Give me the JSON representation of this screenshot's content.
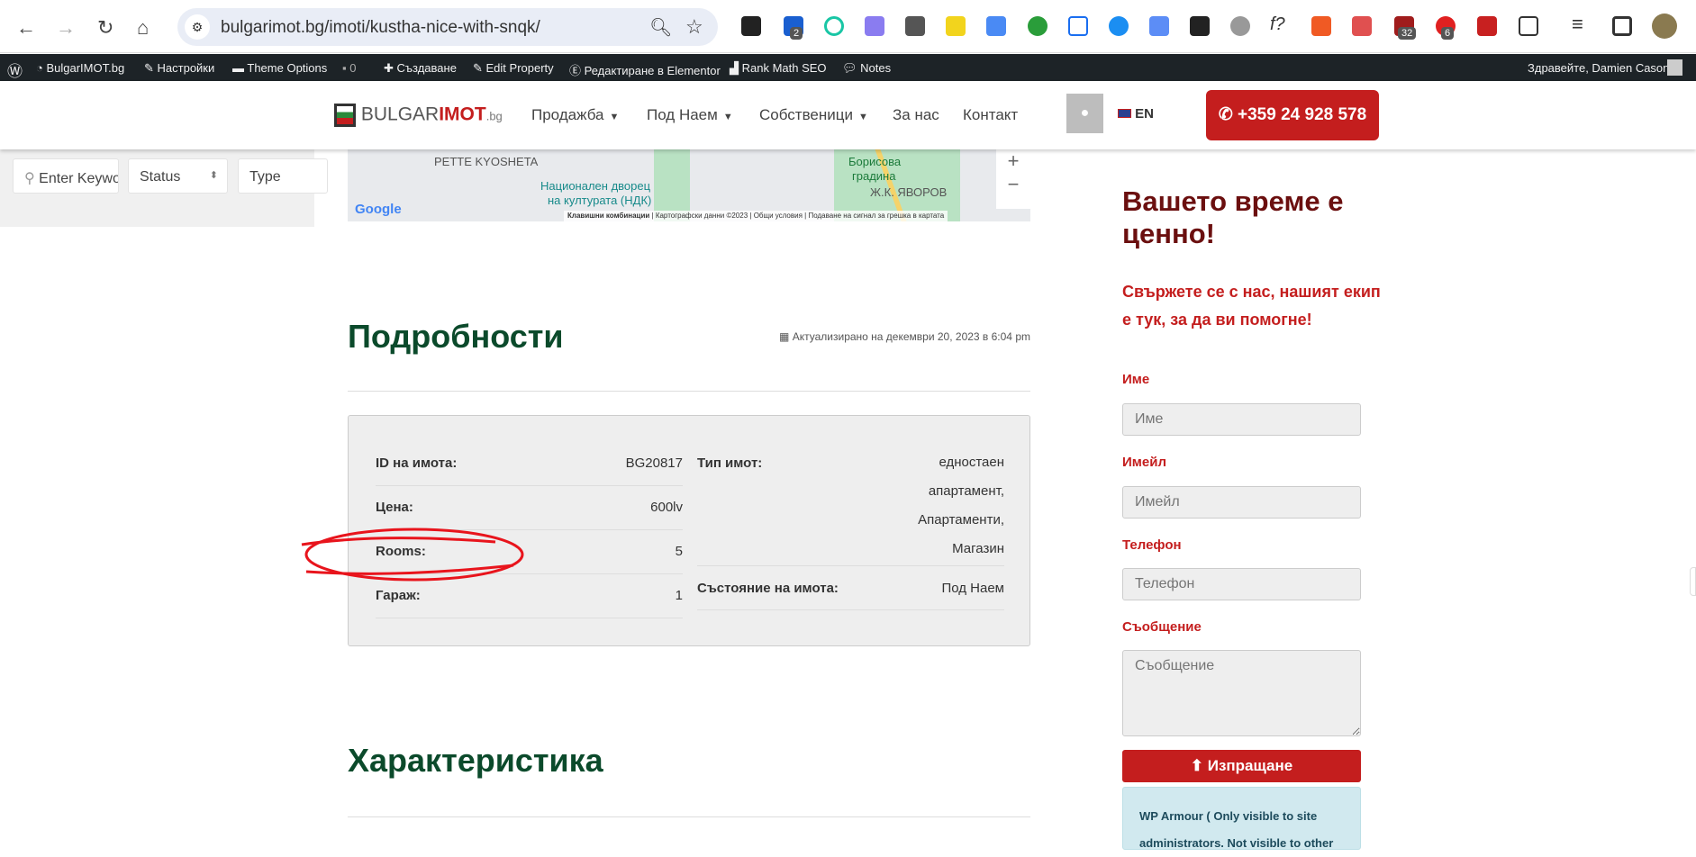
{
  "browser": {
    "url": "bulgarimot.bg/imoti/kustha-nice-with-snqk/",
    "badges": [
      "2",
      "32",
      "6"
    ],
    "ext_f": "f?"
  },
  "adminbar": {
    "items": [
      "BulgarIMOT.bg",
      "Настройки",
      "Theme Options",
      "0",
      "Създаване",
      "Edit Property",
      "Редактиране в Elementor",
      "Rank Math SEO",
      "Notes"
    ],
    "greeting": "Здравейте, Damien Casoni"
  },
  "header": {
    "logo_a": "BULGAR",
    "logo_b": "IMOT",
    "logo_c": ".bg",
    "menu": [
      "Продажба",
      "Под Наем",
      "Собственици",
      "За нас",
      "Контакт"
    ],
    "lang": "EN",
    "phone": "+359 24 928 578"
  },
  "filter": {
    "keyword_placeholder": "Enter Keyword",
    "status": "Status",
    "type": "Type"
  },
  "map": {
    "labels": [
      "PETTE KYOSHETA",
      "Национален дворец",
      "на културата (НДК)",
      "Борисова",
      "градина",
      "Ж.К. ЯВОРОВ"
    ],
    "attribution": [
      "Клавишни комбинации",
      "Картографски данни ©2023",
      "Общи условия",
      "Подаване на сигнал за грешка в картата"
    ],
    "google": "Google"
  },
  "details": {
    "title": "Подробности",
    "updated": "Актуализирано на декември 20, 2023 в 6:04 pm",
    "left": [
      {
        "label": "ID на имота:",
        "value": "BG20817"
      },
      {
        "label": "Цена:",
        "value": "600lv"
      },
      {
        "label": "Rooms:",
        "value": "5"
      },
      {
        "label": "Гараж:",
        "value": "1"
      }
    ],
    "type_label": "Тип имот:",
    "type_lines": [
      "едностаен",
      "апартамент,",
      "Апартаменти,",
      "Магазин"
    ],
    "status_label": "Състояние на имота:",
    "status_value": "Под Наем"
  },
  "features": {
    "title": "Характеристика"
  },
  "sidebar": {
    "title": "Вашето време е ценно!",
    "subtitle": "Свържете се с нас, нашият екип е тук, за да ви помогне!",
    "fields": [
      {
        "label": "Име",
        "placeholder": "Име"
      },
      {
        "label": "Имейл",
        "placeholder": "Имейл"
      },
      {
        "label": "Телефон",
        "placeholder": "Телефон"
      },
      {
        "label": "Съобщение",
        "placeholder": "Съобщение"
      }
    ],
    "submit": "Изпращане",
    "notice": "WP Armour ( Only visible to site administrators. Not visible to other"
  }
}
